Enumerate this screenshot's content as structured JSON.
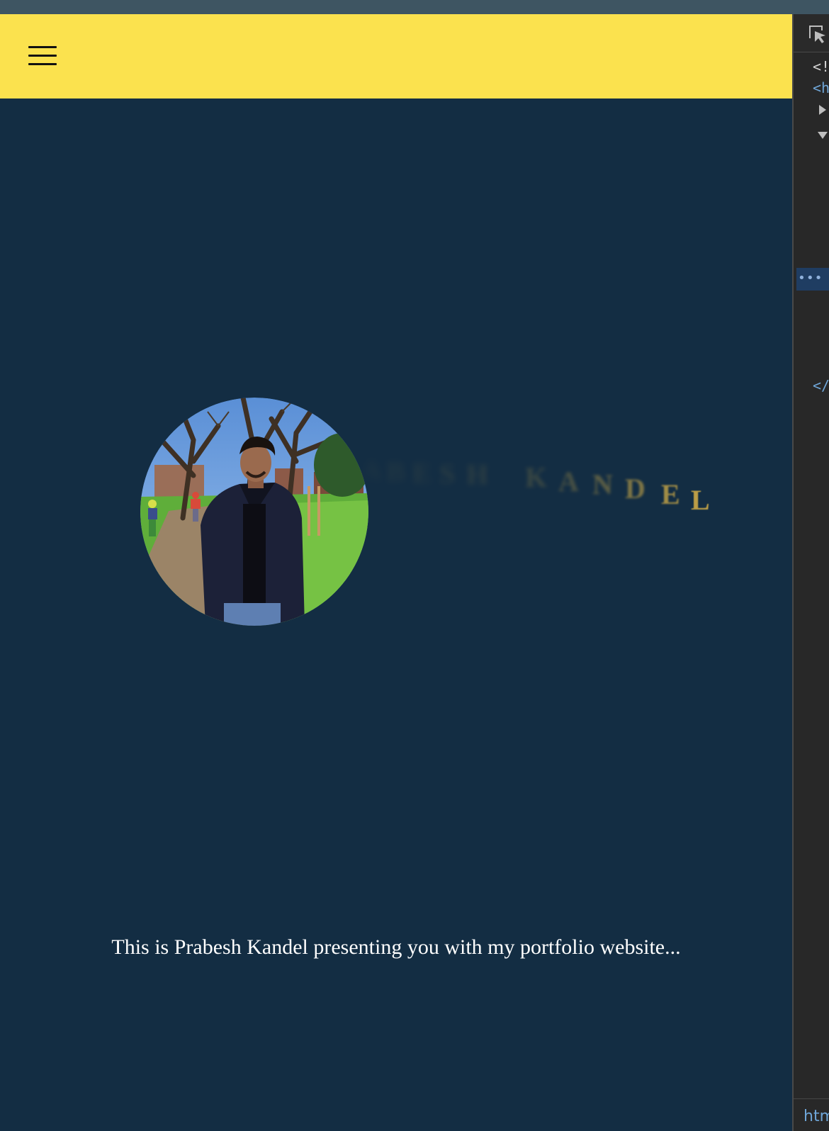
{
  "site": {
    "brand_color": "#fbe24e",
    "background_color": "#132d43",
    "name_color": "#c4a447",
    "nav": {
      "menu_icon": "hamburger-icon"
    },
    "hero": {
      "name_letters": [
        "A",
        "B",
        "E",
        "S",
        "H",
        "K",
        "A",
        "N",
        "D",
        "E",
        "L"
      ],
      "profile_photo": "profile-photo"
    },
    "intro_text": "This is Prabesh Kandel presenting you with my portfolio website..."
  },
  "devtools": {
    "lines": [
      "<!",
      "<h",
      "</"
    ],
    "selected_marker": "•••",
    "footer_tab": "htm"
  }
}
